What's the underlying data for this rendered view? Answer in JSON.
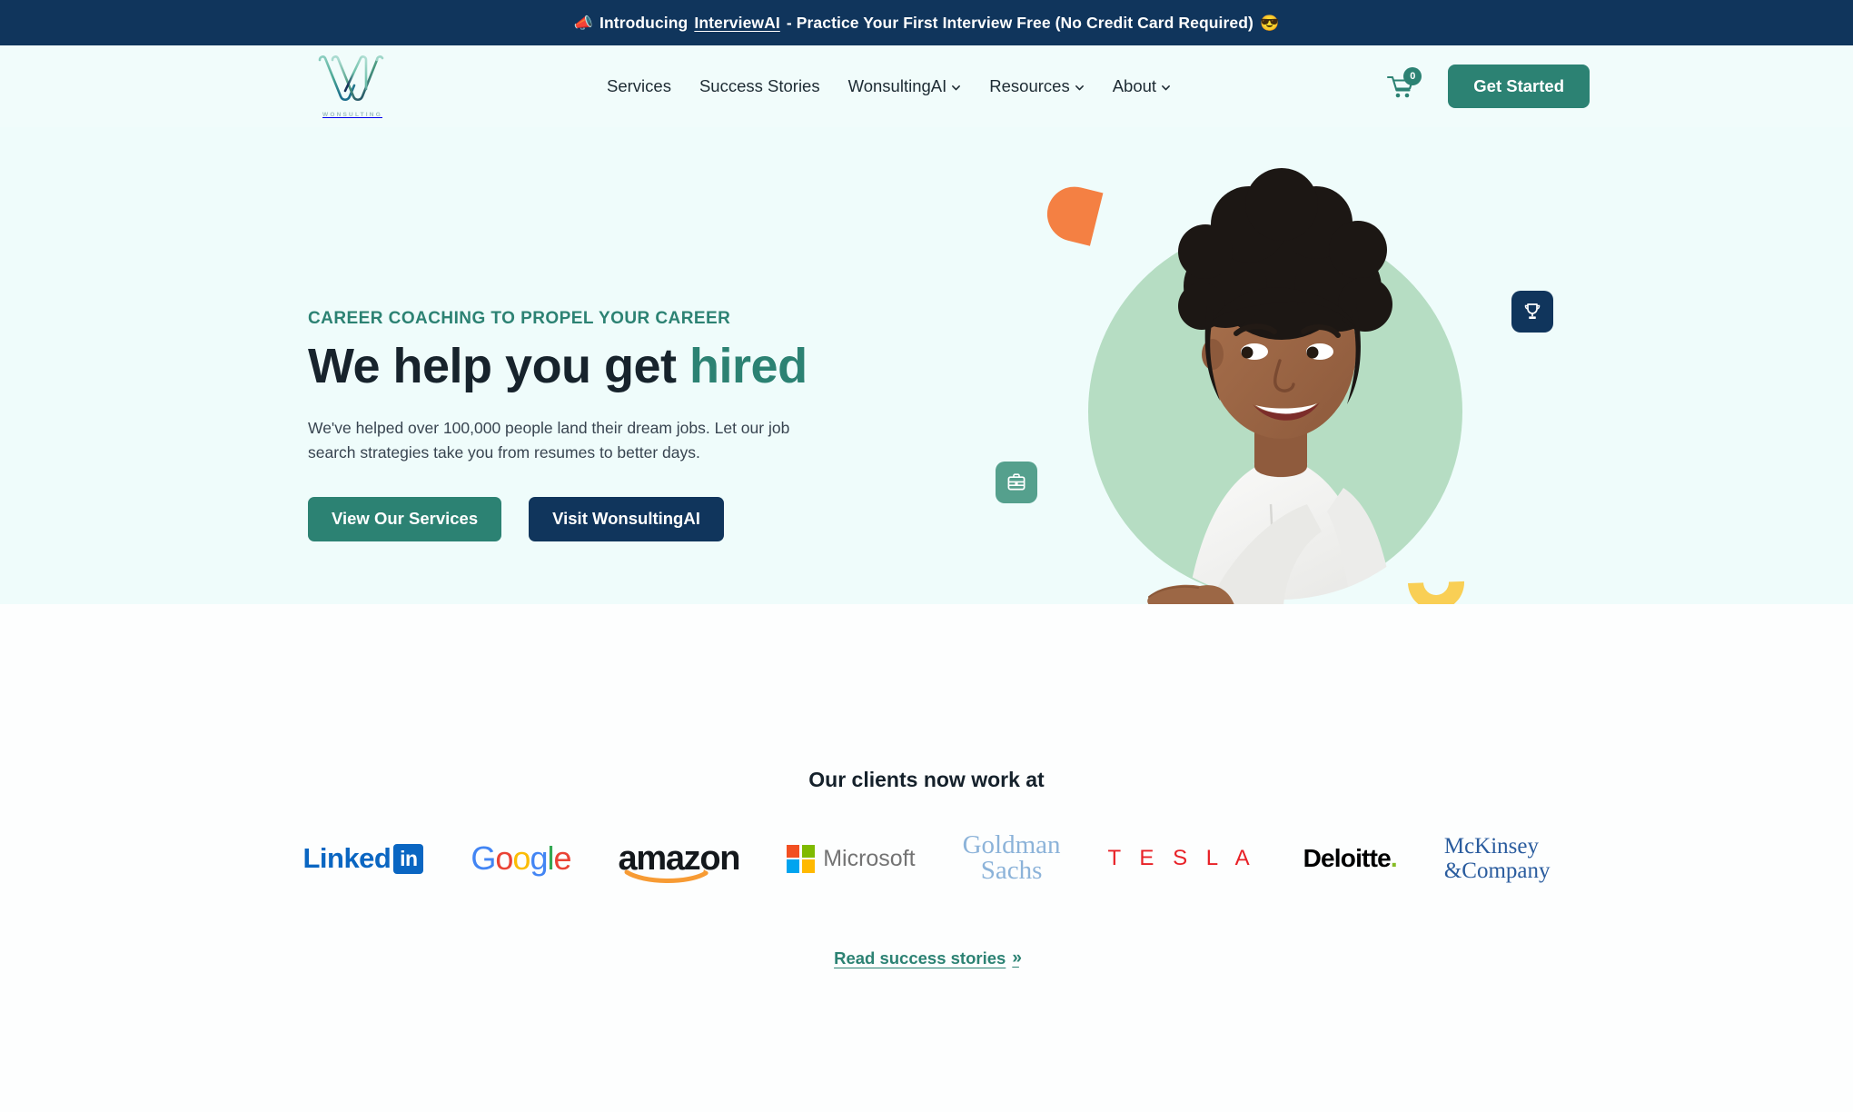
{
  "announcement": {
    "emoji_left": "📣",
    "prefix": "Introducing ",
    "link_label": "InterviewAI",
    "suffix": " - Practice Your First Interview Free (No Credit Card Required) ",
    "emoji_right": "😎",
    "background_color": "#10355c"
  },
  "header": {
    "logo_wordmark": "WONSULTING",
    "nav": [
      {
        "label": "Services",
        "has_dropdown": false
      },
      {
        "label": "Success Stories",
        "has_dropdown": false
      },
      {
        "label": "WonsultingAI",
        "has_dropdown": true
      },
      {
        "label": "Resources",
        "has_dropdown": true
      },
      {
        "label": "About",
        "has_dropdown": true
      }
    ],
    "cart": {
      "icon": "shopping-cart-icon",
      "count": "0"
    },
    "cta_label": "Get Started",
    "accent_color": "#2c8273"
  },
  "hero": {
    "eyebrow": "CAREER COACHING TO PROPEL YOUR CAREER",
    "headline_plain": "We help you get ",
    "headline_accent": "hired",
    "paragraph": "We've helped over 100,000 people land their dream jobs. Let our job search strategies take you from resumes to better days.",
    "primary_button": "View Our Services",
    "secondary_button": "Visit WonsultingAI",
    "art": {
      "trophy_badge_icon": "trophy-icon",
      "briefcase_badge_icon": "briefcase-icon",
      "circle_color": "#b6ddc3",
      "orange_shape_color": "#f48043",
      "yellow_shape_color": "#f9cf55"
    },
    "background_color": "#effcfb"
  },
  "clients": {
    "title": "Our clients now work at",
    "logos": [
      {
        "name": "LinkedIn",
        "text": "Linked",
        "mark": "in"
      },
      {
        "name": "Google",
        "letters": [
          "G",
          "o",
          "o",
          "g",
          "l",
          "e"
        ]
      },
      {
        "name": "amazon",
        "text": "amazon"
      },
      {
        "name": "Microsoft",
        "text": "Microsoft"
      },
      {
        "name": "Goldman Sachs",
        "line1": "Goldman",
        "line2": "Sachs"
      },
      {
        "name": "Tesla",
        "text": "T E S L A"
      },
      {
        "name": "Deloitte",
        "text": "Deloitte",
        "dot": "."
      },
      {
        "name": "McKinsey & Company",
        "line1": "McKinsey",
        "line2": "&Company"
      }
    ],
    "success_link": "Read success stories",
    "success_link_chevron": "»"
  }
}
